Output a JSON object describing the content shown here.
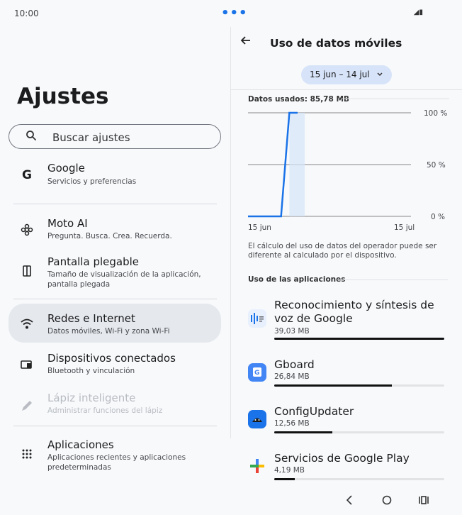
{
  "status": {
    "time": "10:00",
    "dots": "•••",
    "icons": "◢▮"
  },
  "left": {
    "title": "Ajustes",
    "search_placeholder": "Buscar ajustes",
    "items": [
      {
        "title": "Google",
        "subtitle": "Servicios y preferencias",
        "icon": "google-g-icon"
      },
      {
        "title": "Moto AI",
        "subtitle": "Pregunta. Busca. Crea. Recuerda.",
        "icon": "moto-ai-icon"
      },
      {
        "title": "Pantalla plegable",
        "subtitle": "Tamaño de visualización de la aplicación, pantalla plegada",
        "icon": "foldable-screen-icon"
      },
      {
        "title": "Redes e Internet",
        "subtitle": "Datos móviles, Wi-Fi y zona Wi-Fi",
        "icon": "wifi-icon"
      },
      {
        "title": "Dispositivos conectados",
        "subtitle": "Bluetooth y vinculación",
        "icon": "connected-devices-icon"
      },
      {
        "title": "Lápiz inteligente",
        "subtitle": "Administrar funciones del lápiz",
        "icon": "pen-icon"
      },
      {
        "title": "Aplicaciones",
        "subtitle": "Aplicaciones recientes y aplicaciones predeterminadas",
        "icon": "apps-grid-icon"
      }
    ]
  },
  "right": {
    "title": "Uso de datos móviles",
    "date_range": "15 jun – 14 jul",
    "data_used": "Datos usados: 85,78 MB",
    "chart": {
      "y_labels": [
        "100 %",
        "50 %",
        "0 %"
      ],
      "x_labels": [
        "15 jun",
        "15 jul"
      ],
      "usage_percent_points": [
        0,
        0,
        0,
        0,
        0,
        100,
        100
      ]
    },
    "note": "El cálculo del uso de datos del operador puede ser diferente al calculado por el dispositivo.",
    "apps_header": "Uso de las aplicaciones",
    "apps": [
      {
        "name": "Reconocimiento y síntesis de voz de Google",
        "size": "39,03 MB",
        "fraction": 1.0,
        "icon": "speech-services-icon"
      },
      {
        "name": "Gboard",
        "size": "26,84 MB",
        "fraction": 0.69,
        "icon": "gboard-icon"
      },
      {
        "name": "ConfigUpdater",
        "size": "12,56 MB",
        "fraction": 0.34,
        "icon": "config-updater-icon"
      },
      {
        "name": "Servicios de Google Play",
        "size": "4,19 MB",
        "fraction": 0.12,
        "icon": "google-play-services-icon"
      }
    ]
  },
  "colors": {
    "accent": "#1a73e8",
    "chip": "#d7e3f8",
    "selected": "#e5e8ed",
    "bar_fill": "#111111"
  }
}
